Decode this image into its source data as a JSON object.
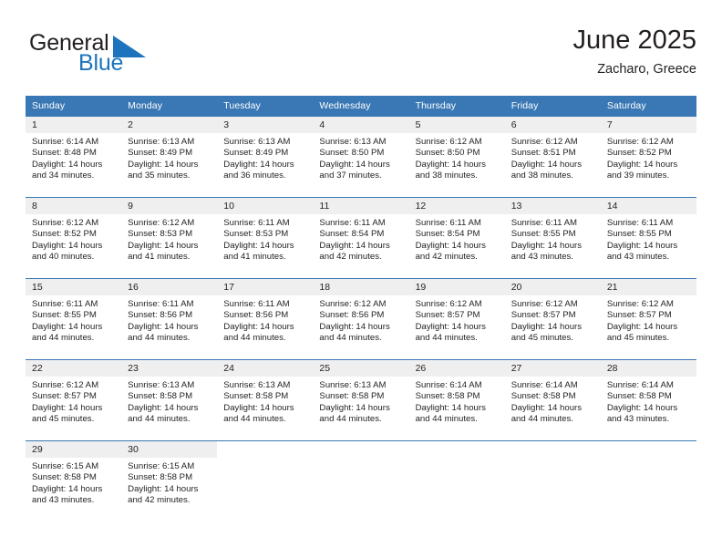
{
  "brand": {
    "name_part1": "General",
    "name_part2": "Blue",
    "mark_icon": "blue-triangle-pennant-icon",
    "accent_color": "#1d74bd"
  },
  "header": {
    "title": "June 2025",
    "subtitle": "Zacharo, Greece"
  },
  "theme": {
    "header_bg": "#3a78b5",
    "daynum_bg": "#efefef",
    "text": "#231f20"
  },
  "calendar": {
    "weekday_headers": [
      "Sunday",
      "Monday",
      "Tuesday",
      "Wednesday",
      "Thursday",
      "Friday",
      "Saturday"
    ],
    "weeks": [
      [
        {
          "day": "1",
          "sunrise": "Sunrise: 6:14 AM",
          "sunset": "Sunset: 8:48 PM",
          "daylight1": "Daylight: 14 hours",
          "daylight2": "and 34 minutes."
        },
        {
          "day": "2",
          "sunrise": "Sunrise: 6:13 AM",
          "sunset": "Sunset: 8:49 PM",
          "daylight1": "Daylight: 14 hours",
          "daylight2": "and 35 minutes."
        },
        {
          "day": "3",
          "sunrise": "Sunrise: 6:13 AM",
          "sunset": "Sunset: 8:49 PM",
          "daylight1": "Daylight: 14 hours",
          "daylight2": "and 36 minutes."
        },
        {
          "day": "4",
          "sunrise": "Sunrise: 6:13 AM",
          "sunset": "Sunset: 8:50 PM",
          "daylight1": "Daylight: 14 hours",
          "daylight2": "and 37 minutes."
        },
        {
          "day": "5",
          "sunrise": "Sunrise: 6:12 AM",
          "sunset": "Sunset: 8:50 PM",
          "daylight1": "Daylight: 14 hours",
          "daylight2": "and 38 minutes."
        },
        {
          "day": "6",
          "sunrise": "Sunrise: 6:12 AM",
          "sunset": "Sunset: 8:51 PM",
          "daylight1": "Daylight: 14 hours",
          "daylight2": "and 38 minutes."
        },
        {
          "day": "7",
          "sunrise": "Sunrise: 6:12 AM",
          "sunset": "Sunset: 8:52 PM",
          "daylight1": "Daylight: 14 hours",
          "daylight2": "and 39 minutes."
        }
      ],
      [
        {
          "day": "8",
          "sunrise": "Sunrise: 6:12 AM",
          "sunset": "Sunset: 8:52 PM",
          "daylight1": "Daylight: 14 hours",
          "daylight2": "and 40 minutes."
        },
        {
          "day": "9",
          "sunrise": "Sunrise: 6:12 AM",
          "sunset": "Sunset: 8:53 PM",
          "daylight1": "Daylight: 14 hours",
          "daylight2": "and 41 minutes."
        },
        {
          "day": "10",
          "sunrise": "Sunrise: 6:11 AM",
          "sunset": "Sunset: 8:53 PM",
          "daylight1": "Daylight: 14 hours",
          "daylight2": "and 41 minutes."
        },
        {
          "day": "11",
          "sunrise": "Sunrise: 6:11 AM",
          "sunset": "Sunset: 8:54 PM",
          "daylight1": "Daylight: 14 hours",
          "daylight2": "and 42 minutes."
        },
        {
          "day": "12",
          "sunrise": "Sunrise: 6:11 AM",
          "sunset": "Sunset: 8:54 PM",
          "daylight1": "Daylight: 14 hours",
          "daylight2": "and 42 minutes."
        },
        {
          "day": "13",
          "sunrise": "Sunrise: 6:11 AM",
          "sunset": "Sunset: 8:55 PM",
          "daylight1": "Daylight: 14 hours",
          "daylight2": "and 43 minutes."
        },
        {
          "day": "14",
          "sunrise": "Sunrise: 6:11 AM",
          "sunset": "Sunset: 8:55 PM",
          "daylight1": "Daylight: 14 hours",
          "daylight2": "and 43 minutes."
        }
      ],
      [
        {
          "day": "15",
          "sunrise": "Sunrise: 6:11 AM",
          "sunset": "Sunset: 8:55 PM",
          "daylight1": "Daylight: 14 hours",
          "daylight2": "and 44 minutes."
        },
        {
          "day": "16",
          "sunrise": "Sunrise: 6:11 AM",
          "sunset": "Sunset: 8:56 PM",
          "daylight1": "Daylight: 14 hours",
          "daylight2": "and 44 minutes."
        },
        {
          "day": "17",
          "sunrise": "Sunrise: 6:11 AM",
          "sunset": "Sunset: 8:56 PM",
          "daylight1": "Daylight: 14 hours",
          "daylight2": "and 44 minutes."
        },
        {
          "day": "18",
          "sunrise": "Sunrise: 6:12 AM",
          "sunset": "Sunset: 8:56 PM",
          "daylight1": "Daylight: 14 hours",
          "daylight2": "and 44 minutes."
        },
        {
          "day": "19",
          "sunrise": "Sunrise: 6:12 AM",
          "sunset": "Sunset: 8:57 PM",
          "daylight1": "Daylight: 14 hours",
          "daylight2": "and 44 minutes."
        },
        {
          "day": "20",
          "sunrise": "Sunrise: 6:12 AM",
          "sunset": "Sunset: 8:57 PM",
          "daylight1": "Daylight: 14 hours",
          "daylight2": "and 45 minutes."
        },
        {
          "day": "21",
          "sunrise": "Sunrise: 6:12 AM",
          "sunset": "Sunset: 8:57 PM",
          "daylight1": "Daylight: 14 hours",
          "daylight2": "and 45 minutes."
        }
      ],
      [
        {
          "day": "22",
          "sunrise": "Sunrise: 6:12 AM",
          "sunset": "Sunset: 8:57 PM",
          "daylight1": "Daylight: 14 hours",
          "daylight2": "and 45 minutes."
        },
        {
          "day": "23",
          "sunrise": "Sunrise: 6:13 AM",
          "sunset": "Sunset: 8:58 PM",
          "daylight1": "Daylight: 14 hours",
          "daylight2": "and 44 minutes."
        },
        {
          "day": "24",
          "sunrise": "Sunrise: 6:13 AM",
          "sunset": "Sunset: 8:58 PM",
          "daylight1": "Daylight: 14 hours",
          "daylight2": "and 44 minutes."
        },
        {
          "day": "25",
          "sunrise": "Sunrise: 6:13 AM",
          "sunset": "Sunset: 8:58 PM",
          "daylight1": "Daylight: 14 hours",
          "daylight2": "and 44 minutes."
        },
        {
          "day": "26",
          "sunrise": "Sunrise: 6:14 AM",
          "sunset": "Sunset: 8:58 PM",
          "daylight1": "Daylight: 14 hours",
          "daylight2": "and 44 minutes."
        },
        {
          "day": "27",
          "sunrise": "Sunrise: 6:14 AM",
          "sunset": "Sunset: 8:58 PM",
          "daylight1": "Daylight: 14 hours",
          "daylight2": "and 44 minutes."
        },
        {
          "day": "28",
          "sunrise": "Sunrise: 6:14 AM",
          "sunset": "Sunset: 8:58 PM",
          "daylight1": "Daylight: 14 hours",
          "daylight2": "and 43 minutes."
        }
      ],
      [
        {
          "day": "29",
          "sunrise": "Sunrise: 6:15 AM",
          "sunset": "Sunset: 8:58 PM",
          "daylight1": "Daylight: 14 hours",
          "daylight2": "and 43 minutes."
        },
        {
          "day": "30",
          "sunrise": "Sunrise: 6:15 AM",
          "sunset": "Sunset: 8:58 PM",
          "daylight1": "Daylight: 14 hours",
          "daylight2": "and 42 minutes."
        },
        null,
        null,
        null,
        null,
        null
      ]
    ]
  }
}
